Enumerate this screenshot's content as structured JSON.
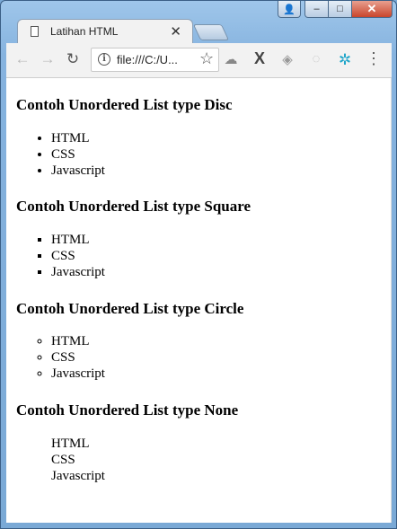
{
  "window": {
    "user_glyph": "👤",
    "min_glyph": "–",
    "max_glyph": "□",
    "close_glyph": "✕"
  },
  "tab": {
    "title": "Latihan HTML",
    "close_glyph": "✕"
  },
  "toolbar": {
    "back_glyph": "←",
    "forward_glyph": "→",
    "reload_glyph": "↻",
    "info_glyph": "i",
    "url": "file:///C:/U...",
    "star_glyph": "☆",
    "menu_glyph": "⋮"
  },
  "extensions": [
    {
      "name": "extension-cloud-icon",
      "glyph": "☁"
    },
    {
      "name": "extension-x-icon",
      "glyph": "X"
    },
    {
      "name": "extension-shield-icon",
      "glyph": "◈"
    },
    {
      "name": "extension-refresh-icon",
      "glyph": "◌"
    },
    {
      "name": "extension-gear-icon",
      "glyph": "✲"
    }
  ],
  "sections": [
    {
      "heading": "Contoh Unordered List type Disc",
      "list_type": "disc",
      "items": [
        "HTML",
        "CSS",
        "Javascript"
      ]
    },
    {
      "heading": "Contoh Unordered List type Square",
      "list_type": "square",
      "items": [
        "HTML",
        "CSS",
        "Javascript"
      ]
    },
    {
      "heading": "Contoh Unordered List type Circle",
      "list_type": "circle",
      "items": [
        "HTML",
        "CSS",
        "Javascript"
      ]
    },
    {
      "heading": "Contoh Unordered List type None",
      "list_type": "none",
      "items": [
        "HTML",
        "CSS",
        "Javascript"
      ]
    }
  ]
}
